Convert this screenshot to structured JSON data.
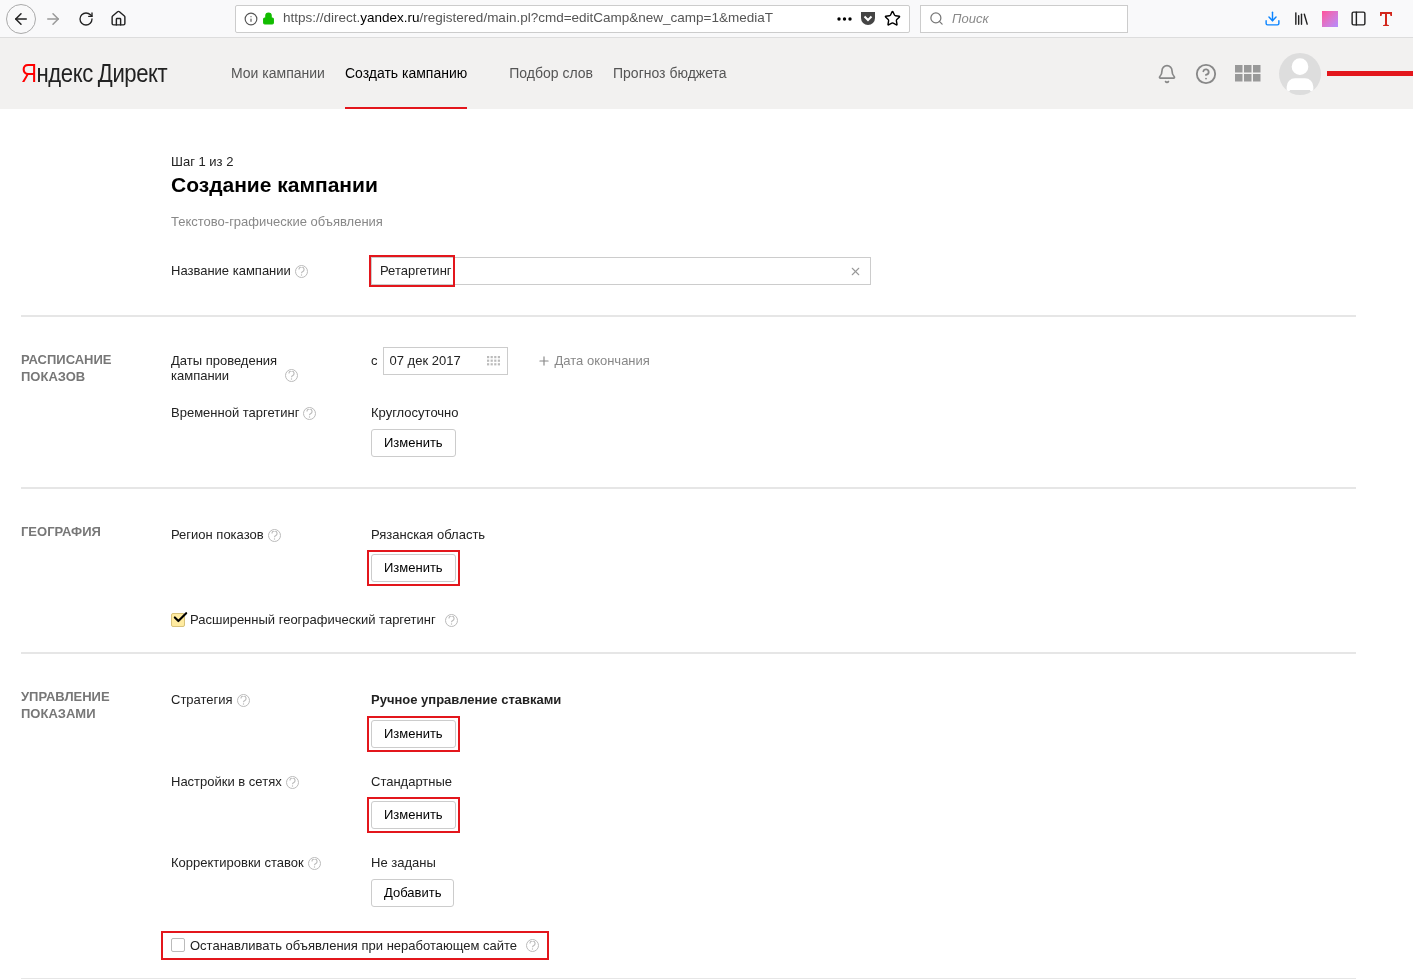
{
  "browser": {
    "url_prefix": "https://direct.",
    "url_domain": "yandex.ru",
    "url_rest": "/registered/main.pl?cmd=editCamp&new_camp=1&mediaT",
    "search": {
      "placeholder": "Поиск"
    }
  },
  "header": {
    "logo_brand": "Яндекс",
    "logo_product": "Директ",
    "nav": [
      {
        "label": "Мои кампании",
        "selected": false
      },
      {
        "label": "Создать кампанию",
        "selected": true
      },
      {
        "label": "Подбор слов",
        "selected": false
      },
      {
        "label": "Прогноз бюджета",
        "selected": false
      }
    ],
    "user_redacted": true
  },
  "page": {
    "step": "Шаг 1 из 2",
    "title": "Создание кампании",
    "subtitle": "Текстово-графические объявления",
    "name_field": {
      "label": "Название кампании",
      "value": "Ретаргетинг",
      "highlighted": true
    }
  },
  "sections": [
    {
      "title": "РАСПИСАНИЕ ПОКАЗОВ",
      "rows": [
        {
          "kind": "dates",
          "label": "Даты проведения кампании",
          "prefix": "с",
          "date": "07 дек 2017",
          "end_link": "Дата окончания"
        },
        {
          "kind": "setting",
          "label": "Временной таргетинг",
          "value": "Круглосуточно",
          "bold": false,
          "button": "Изменить",
          "highlighted": false
        }
      ]
    },
    {
      "title": "ГЕОГРАФИЯ",
      "rows": [
        {
          "kind": "setting",
          "label": "Регион показов",
          "value": "Рязанская область",
          "bold": false,
          "button": "Изменить",
          "highlighted": true
        },
        {
          "kind": "checkbox",
          "label": "Расширенный географический таргетинг",
          "checked": true,
          "highlighted": false
        }
      ]
    },
    {
      "title": "УПРАВЛЕНИЕ ПОКАЗАМИ",
      "rows": [
        {
          "kind": "setting",
          "label": "Стратегия",
          "value": "Ручное управление ставками",
          "bold": true,
          "button": "Изменить",
          "highlighted": true
        },
        {
          "kind": "setting",
          "label": "Настройки в сетях",
          "value": "Стандартные",
          "bold": false,
          "button": "Изменить",
          "highlighted": true
        },
        {
          "kind": "setting",
          "label": "Корректировки ставок",
          "value": "Не заданы",
          "bold": false,
          "button": "Добавить",
          "highlighted": false
        },
        {
          "kind": "checkbox",
          "label": "Останавливать объявления при неработающем сайте",
          "checked": false,
          "highlighted": true
        }
      ]
    }
  ]
}
